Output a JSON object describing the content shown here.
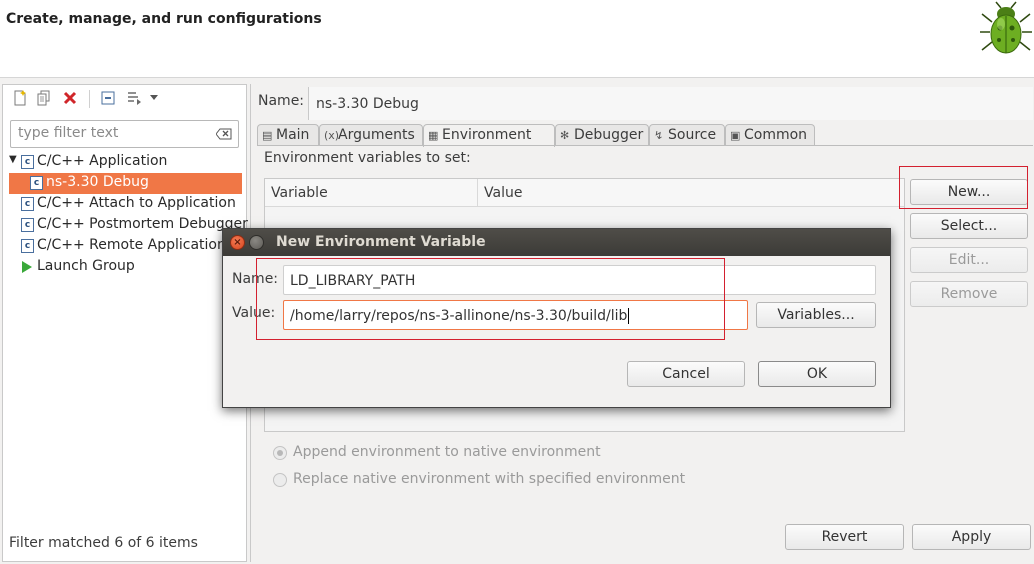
{
  "header": {
    "title": "Create, manage, and run configurations"
  },
  "left": {
    "filter_placeholder": "type filter text",
    "tree": [
      {
        "label": "C/C++ Application",
        "expanded": true
      },
      {
        "label": "ns-3.30 Debug",
        "selected": true
      },
      {
        "label": "C/C++ Attach to Application"
      },
      {
        "label": "C/C++ Postmortem Debugger"
      },
      {
        "label": "C/C++ Remote Application"
      },
      {
        "label": "Launch Group"
      }
    ],
    "status": "Filter matched 6 of 6 items"
  },
  "right": {
    "name_label": "Name:",
    "name_value": "ns-3.30 Debug",
    "tabs": [
      "Main",
      "Arguments",
      "Environment",
      "Debugger",
      "Source",
      "Common"
    ],
    "active_tab": "Environment",
    "env_label": "Environment variables to set:",
    "columns": [
      "Variable",
      "Value"
    ],
    "buttons": {
      "new": "New...",
      "select": "Select...",
      "edit": "Edit...",
      "remove": "Remove"
    },
    "radio_append": "Append environment to native environment",
    "radio_replace": "Replace native environment with specified environment",
    "revert": "Revert",
    "apply": "Apply"
  },
  "dialog": {
    "title": "New Environment Variable",
    "name_label": "Name:",
    "name_value": "LD_LIBRARY_PATH",
    "value_label": "Value:",
    "value_value": "/home/larry/repos/ns-3-allinone/ns-3.30/build/lib",
    "variables_button": "Variables...",
    "cancel": "Cancel",
    "ok": "OK"
  },
  "colors": {
    "selection": "#f07746",
    "highlight_box": "#d3202f",
    "titlebar": "#3c3b37"
  }
}
